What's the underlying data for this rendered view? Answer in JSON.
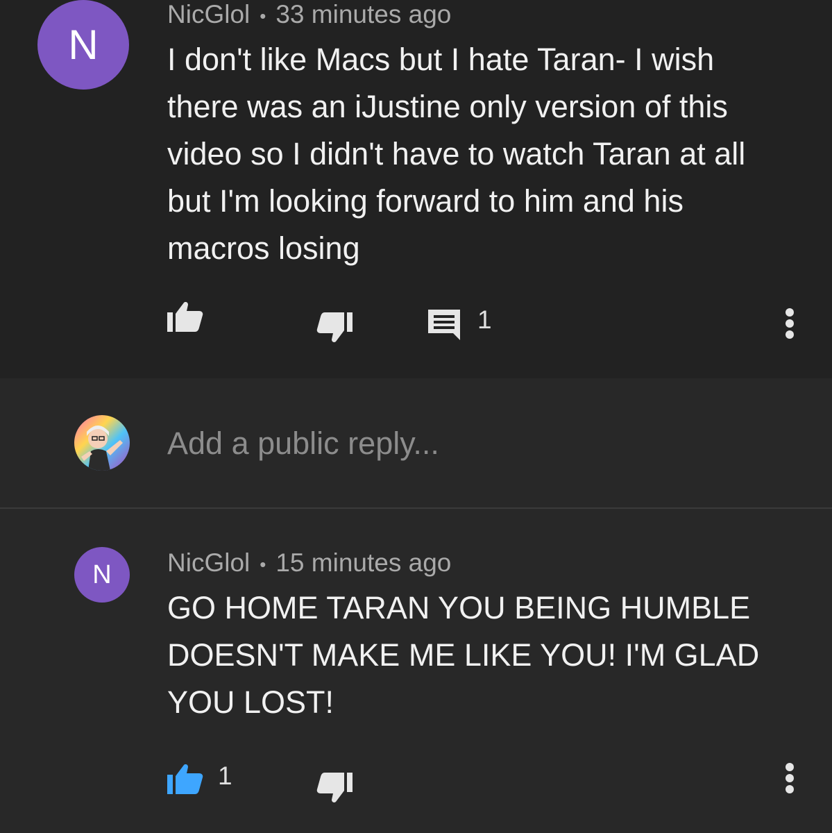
{
  "comment": {
    "avatar_letter": "N",
    "author": "NicGlol",
    "separator": "•",
    "time": "33 minutes ago",
    "text": "I don't like Macs but I hate Taran- I wish there was an iJustine only version of this video so I didn't have to watch Taran at all but I'm looking forward to him and his macros losing",
    "reply_count": "1",
    "icons": [
      "like-icon",
      "dislike-icon",
      "reply-icon",
      "more-vert-icon"
    ]
  },
  "reply_input": {
    "placeholder": "Add a public reply..."
  },
  "reply": {
    "avatar_letter": "N",
    "author": "NicGlol",
    "separator": "•",
    "time": "15 minutes ago",
    "text": "GO HOME TARAN YOU BEING HUMBLE DOESN'T MAKE ME LIKE YOU! I'M GLAD YOU LOST!",
    "like_count": "1",
    "liked": true,
    "icons": [
      "like-icon",
      "dislike-icon",
      "more-vert-icon"
    ]
  },
  "colors": {
    "background": "#212121",
    "avatar": "#7e57c2",
    "like_active": "#3ea6ff",
    "text": "#f1f1f1",
    "meta": "#aaaaaa"
  }
}
